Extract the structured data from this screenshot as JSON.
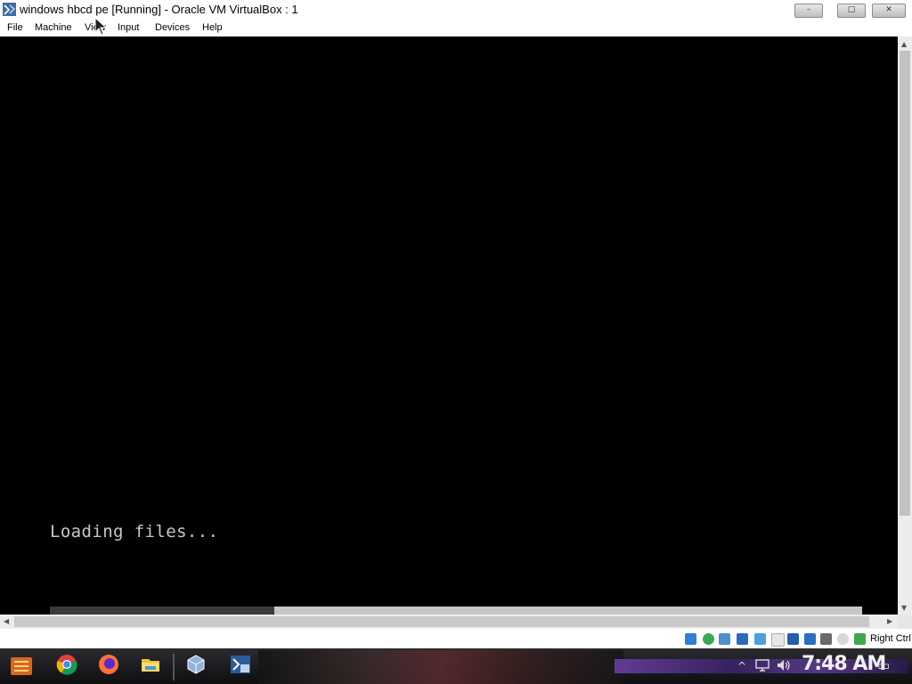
{
  "window": {
    "title": "windows hbcd pe [Running] - Oracle VM VirtualBox : 1",
    "minimize_glyph": "–",
    "maximize_glyph": "□",
    "close_glyph": "✕"
  },
  "menu": {
    "items": [
      "File",
      "Machine",
      "View",
      "Input",
      "Devices",
      "Help"
    ]
  },
  "console": {
    "text": "Loading files..."
  },
  "status_bar": {
    "host_key_label": "Right Ctrl",
    "icons": [
      "hard-disk-icon",
      "optical-drive-icon",
      "audio-icon",
      "network-icon",
      "usb-icon",
      "shared-folders-icon",
      "display-icon",
      "video-capture-icon",
      "virtualization-icon",
      "cpu-icon",
      "mouse-integration-icon",
      "keyboard-capture-icon"
    ]
  },
  "taskbar": {
    "clock": "7:48 AM",
    "apps": [
      "start-icon",
      "chrome-icon",
      "firefox-icon",
      "file-explorer-icon",
      "virtualbox-icon",
      "virtualbox-vm-icon"
    ],
    "tray_overflow_glyph": "^",
    "notification_glyph": "▭"
  },
  "colors": {
    "vm_background": "#000000",
    "console_text": "#c8c8c8",
    "chrome": "#ffffff",
    "taskbar": "#1a1a1e"
  }
}
